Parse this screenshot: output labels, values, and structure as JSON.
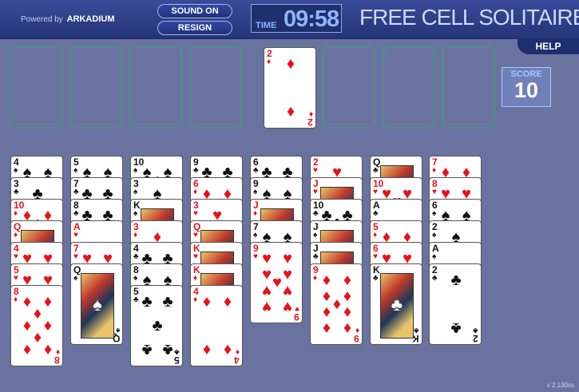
{
  "header": {
    "powered_by": "Powered by",
    "brand": "ARKADIUM",
    "sound_label": "SOUND ON",
    "resign_label": "RESIGN",
    "time_label": "TIME",
    "time_value": "09:58",
    "title": "FREE CELL SOLITAIRE",
    "help_label": "HELP"
  },
  "score": {
    "label": "SCORE",
    "value": "10"
  },
  "version": "v 2.130ss",
  "colors": {
    "background": "#6a739f",
    "header": "#2b3b86",
    "red_suit": "#e8121a",
    "black_suit": "#111111"
  },
  "foundations": [
    {
      "rank": "2",
      "suit": "diamonds"
    },
    null,
    null,
    null
  ],
  "columns": [
    {
      "cards": [
        {
          "rank": "4",
          "suit": "spades"
        },
        {
          "rank": "3",
          "suit": "clubs"
        },
        {
          "rank": "10",
          "suit": "diamonds"
        },
        {
          "rank": "Q",
          "suit": "diamonds"
        },
        {
          "rank": "4",
          "suit": "hearts"
        },
        {
          "rank": "5",
          "suit": "hearts"
        },
        {
          "rank": "8",
          "suit": "diamonds"
        }
      ]
    },
    {
      "cards": [
        {
          "rank": "5",
          "suit": "spades"
        },
        {
          "rank": "7",
          "suit": "clubs"
        },
        {
          "rank": "8",
          "suit": "clubs"
        },
        {
          "rank": "A",
          "suit": "hearts"
        },
        {
          "rank": "7",
          "suit": "hearts"
        },
        {
          "rank": "Q",
          "suit": "spades"
        }
      ]
    },
    {
      "cards": [
        {
          "rank": "10",
          "suit": "spades"
        },
        {
          "rank": "3",
          "suit": "spades"
        },
        {
          "rank": "K",
          "suit": "spades"
        },
        {
          "rank": "3",
          "suit": "diamonds"
        },
        {
          "rank": "4",
          "suit": "clubs"
        },
        {
          "rank": "8",
          "suit": "spades"
        },
        {
          "rank": "5",
          "suit": "clubs"
        }
      ]
    },
    {
      "cards": [
        {
          "rank": "9",
          "suit": "clubs"
        },
        {
          "rank": "6",
          "suit": "diamonds"
        },
        {
          "rank": "3",
          "suit": "hearts"
        },
        {
          "rank": "Q",
          "suit": "hearts"
        },
        {
          "rank": "K",
          "suit": "hearts"
        },
        {
          "rank": "K",
          "suit": "diamonds"
        },
        {
          "rank": "4",
          "suit": "diamonds"
        }
      ]
    },
    {
      "cards": [
        {
          "rank": "6",
          "suit": "clubs"
        },
        {
          "rank": "9",
          "suit": "spades"
        },
        {
          "rank": "J",
          "suit": "diamonds"
        },
        {
          "rank": "7",
          "suit": "spades"
        },
        {
          "rank": "9",
          "suit": "hearts"
        }
      ]
    },
    {
      "cards": [
        {
          "rank": "2",
          "suit": "hearts"
        },
        {
          "rank": "J",
          "suit": "hearts"
        },
        {
          "rank": "10",
          "suit": "clubs"
        },
        {
          "rank": "J",
          "suit": "spades"
        },
        {
          "rank": "J",
          "suit": "clubs"
        },
        {
          "rank": "9",
          "suit": "diamonds"
        }
      ]
    },
    {
      "cards": [
        {
          "rank": "Q",
          "suit": "clubs"
        },
        {
          "rank": "10",
          "suit": "hearts"
        },
        {
          "rank": "A",
          "suit": "clubs"
        },
        {
          "rank": "5",
          "suit": "diamonds"
        },
        {
          "rank": "6",
          "suit": "hearts"
        },
        {
          "rank": "K",
          "suit": "clubs"
        }
      ]
    },
    {
      "cards": [
        {
          "rank": "7",
          "suit": "diamonds"
        },
        {
          "rank": "8",
          "suit": "hearts"
        },
        {
          "rank": "6",
          "suit": "spades"
        },
        {
          "rank": "2",
          "suit": "spades"
        },
        {
          "rank": "A",
          "suit": "spades"
        },
        {
          "rank": "2",
          "suit": "clubs"
        }
      ]
    }
  ]
}
